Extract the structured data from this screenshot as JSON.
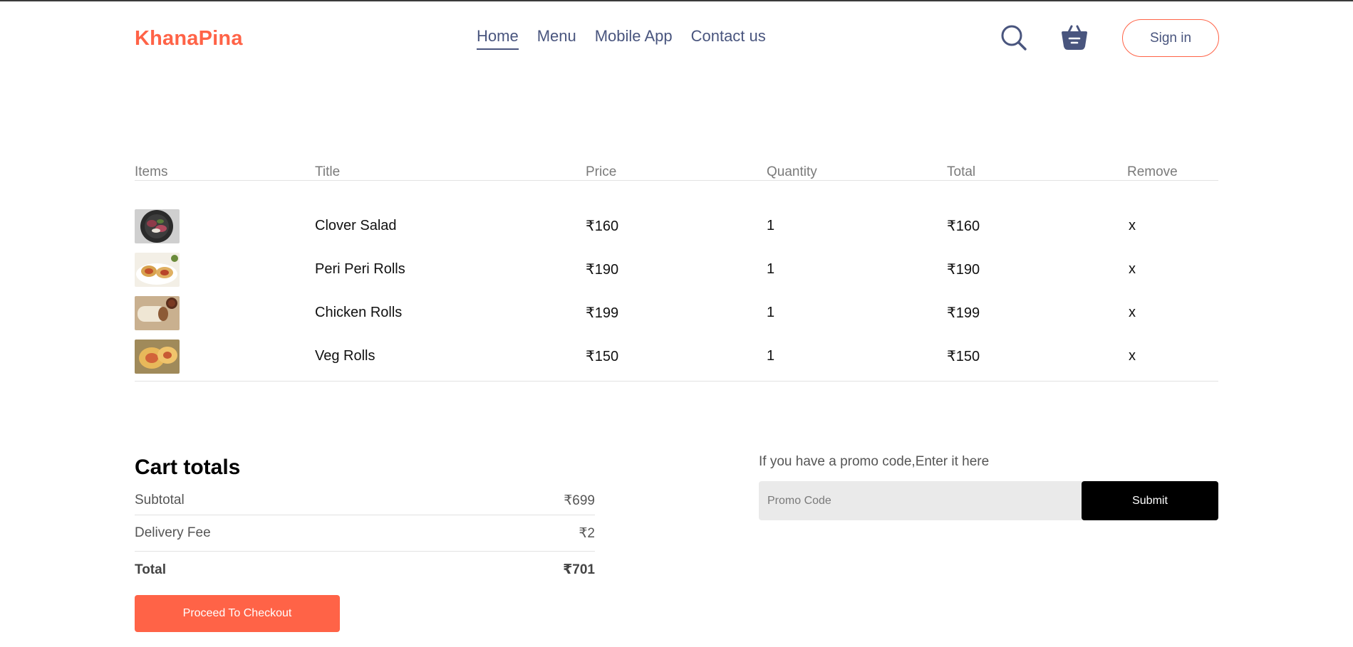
{
  "brand": {
    "logo": "KhanaPina",
    "accent": "#ff6347",
    "text_color": "#49557e"
  },
  "nav": {
    "items": [
      {
        "label": "Home",
        "active": true
      },
      {
        "label": "Menu",
        "active": false
      },
      {
        "label": "Mobile App",
        "active": false
      },
      {
        "label": "Contact us",
        "active": false
      }
    ],
    "icons": [
      "search-icon",
      "basket-icon"
    ],
    "signin_label": "Sign in"
  },
  "cart": {
    "headers": [
      "Items",
      "Title",
      "Price",
      "Quantity",
      "Total",
      "Remove"
    ],
    "items": [
      {
        "image": "clover-salad-image",
        "title": "Clover Salad",
        "price": "₹160",
        "quantity": "1",
        "total": "₹160",
        "remove": "x"
      },
      {
        "image": "peri-peri-rolls-image",
        "title": "Peri Peri Rolls",
        "price": "₹190",
        "quantity": "1",
        "total": "₹190",
        "remove": "x"
      },
      {
        "image": "chicken-rolls-image",
        "title": "Chicken Rolls",
        "price": "₹199",
        "quantity": "1",
        "total": "₹199",
        "remove": "x"
      },
      {
        "image": "veg-rolls-image",
        "title": "Veg Rolls",
        "price": "₹150",
        "quantity": "1",
        "total": "₹150",
        "remove": "x"
      }
    ]
  },
  "totals": {
    "heading": "Cart totals",
    "subtotal_label": "Subtotal",
    "subtotal_value": "₹699",
    "delivery_label": "Delivery Fee",
    "delivery_value": "₹2",
    "total_label": "Total",
    "total_value": "₹701",
    "checkout_label": "Proceed To Checkout"
  },
  "promo": {
    "prompt": "If you have a promo code,Enter it here",
    "placeholder": "Promo Code",
    "submit_label": "Submit"
  }
}
